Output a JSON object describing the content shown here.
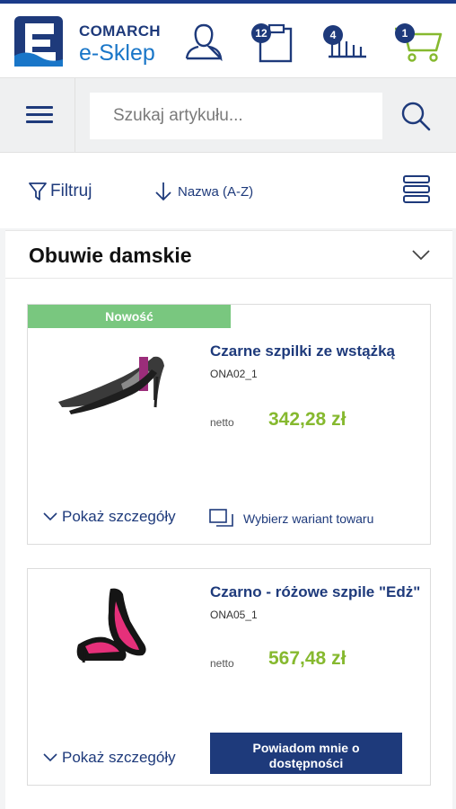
{
  "header": {
    "brand_top": "COMARCH",
    "brand_bottom": "e-Sklep",
    "account_icon": "user-icon",
    "clipboard_badge": "12",
    "compare_badge": "4",
    "cart_badge": "1",
    "colors": {
      "brand_dark": "#1e3a7b",
      "brand_light": "#1976c8",
      "cart": "#86b92f"
    }
  },
  "search": {
    "placeholder": "Szukaj artykułu...",
    "value": ""
  },
  "toolbar": {
    "filter_label": "Filtruj",
    "sort_label": "Nazwa (A-Z)"
  },
  "category": {
    "title": "Obuwie damskie"
  },
  "products": [
    {
      "badge": "Nowość",
      "name": "Czarne szpilki ze wstążką",
      "code": "ONA02_1",
      "netto_label": "netto",
      "price": "342,28 zł",
      "details_label": "Pokaż szczegóły",
      "variant_label": "Wybierz wariant towaru"
    },
    {
      "name": "Czarno - różowe szpile \"Edż\"",
      "code": "ONA05_1",
      "netto_label": "netto",
      "price": "567,48 zł",
      "details_label": "Pokaż szczegóły",
      "notify_label": "Powiadom mnie o dostępności"
    }
  ]
}
